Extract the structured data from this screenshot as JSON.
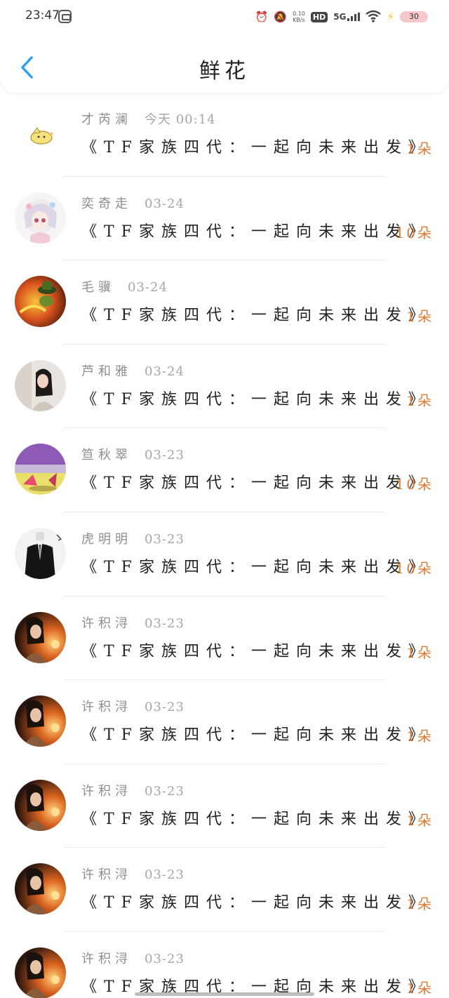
{
  "status_bar": {
    "time": "23:47",
    "network_speed_value": "0.10",
    "network_speed_unit": "KB/s",
    "hd_label": "HD",
    "signal_label": "5G",
    "battery_level": "30",
    "colors": {
      "battery_bg": "#f6c8cc",
      "charging_bolt": "#f5c518"
    }
  },
  "header": {
    "title": "鲜花",
    "back_icon": "chevron-left-icon",
    "colors": {
      "back_icon": "#2a9df4"
    }
  },
  "list": {
    "colors": {
      "count": "#e07a35",
      "name": "#8e8e8e"
    },
    "items": [
      {
        "name": "才芮澜",
        "time": "今天 00:14",
        "content": "《TF家族四代：一起向未来出发》",
        "count": "1朵",
        "avatar": "cartoon-sticker"
      },
      {
        "name": "奕奇走",
        "time": "03-24",
        "content": "《TF家族四代：一起向未来出发》",
        "count": "10朵",
        "avatar": "anime-girl"
      },
      {
        "name": "毛骥",
        "time": "03-24",
        "content": "《TF家族四代：一起向未来出发》",
        "count": "1朵",
        "avatar": "game-character"
      },
      {
        "name": "芦和雅",
        "time": "03-24",
        "content": "《TF家族四代：一起向未来出发》",
        "count": "1朵",
        "avatar": "girl-photo"
      },
      {
        "name": "笪秋翠",
        "time": "03-23",
        "content": "《TF家族四代：一起向未来出发》",
        "count": "10朵",
        "avatar": "colorful-scene"
      },
      {
        "name": "虎明明",
        "time": "03-23",
        "content": "《TF家族四代：一起向未来出发》",
        "count": "10朵",
        "avatar": "suit-figure"
      },
      {
        "name": "许积浔",
        "time": "03-23",
        "content": "《TF家族四代：一起向未来出发》",
        "count": "1朵",
        "avatar": "fire-portrait"
      },
      {
        "name": "许积浔",
        "time": "03-23",
        "content": "《TF家族四代：一起向未来出发》",
        "count": "1朵",
        "avatar": "fire-portrait"
      },
      {
        "name": "许积浔",
        "time": "03-23",
        "content": "《TF家族四代：一起向未来出发》",
        "count": "1朵",
        "avatar": "fire-portrait"
      },
      {
        "name": "许积浔",
        "time": "03-23",
        "content": "《TF家族四代：一起向未来出发》",
        "count": "1朵",
        "avatar": "fire-portrait"
      },
      {
        "name": "许积浔",
        "time": "03-23",
        "content": "《TF家族四代：一起向未来出发》",
        "count": "1朵",
        "avatar": "fire-portrait"
      }
    ]
  }
}
